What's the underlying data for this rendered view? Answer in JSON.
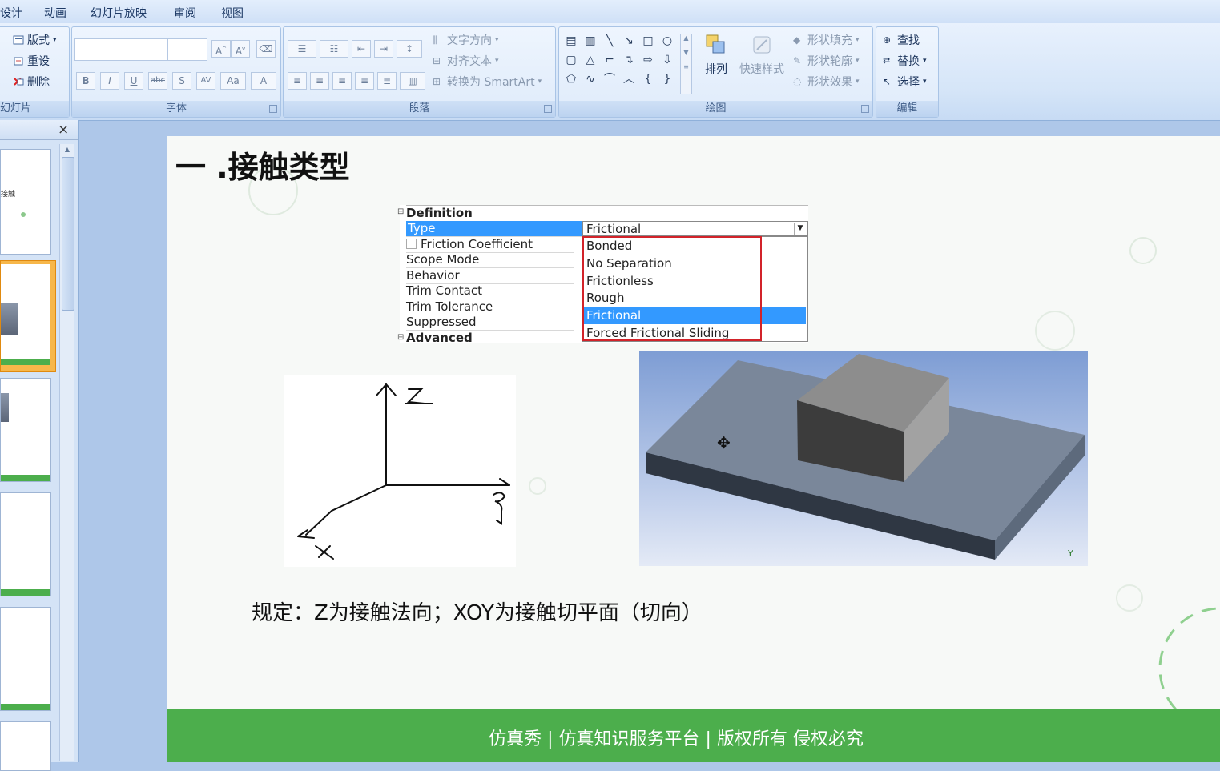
{
  "menu": [
    "设计",
    "动画",
    "幻灯片放映",
    "审阅",
    "视图"
  ],
  "ribbon": {
    "slides_group": {
      "label": "幻灯片",
      "layout": "版式",
      "reset": "重设",
      "delete": "删除"
    },
    "font_group": {
      "label": "字体",
      "buttons": [
        "B",
        "I",
        "U",
        "abc",
        "S",
        "AV",
        "Aa",
        "A"
      ]
    },
    "paragraph_group": {
      "label": "段落",
      "text_direction": "文字方向",
      "align_text": "对齐文本",
      "convert_smartart": "转换为 SmartArt"
    },
    "drawing_group": {
      "label": "绘图",
      "arrange": "排列",
      "quick_styles": "快速样式",
      "shape_fill": "形状填充",
      "shape_outline": "形状轮廓",
      "shape_effects": "形状效果"
    },
    "editing_group": {
      "label": "编辑",
      "find": "查找",
      "replace": "替换",
      "select": "选择"
    }
  },
  "thumbnail_pane": {
    "close_glyph": "×",
    "thumb1_text": "接触"
  },
  "slide": {
    "title": "一 .接触类型",
    "property_grid": {
      "section_definition": "Definition",
      "section_advanced": "Advanced",
      "rows": [
        {
          "name": "Type",
          "value": "Frictional"
        },
        {
          "name": "Friction Coefficient",
          "value": ""
        },
        {
          "name": "Scope Mode",
          "value": ""
        },
        {
          "name": "Behavior",
          "value": ""
        },
        {
          "name": "Trim Contact",
          "value": ""
        },
        {
          "name": "Trim Tolerance",
          "value": ""
        },
        {
          "name": "Suppressed",
          "value": ""
        }
      ],
      "dropdown_options": [
        "Bonded",
        "No Separation",
        "Frictionless",
        "Rough",
        "Frictional",
        "Forced Frictional Sliding"
      ],
      "selected_option": "Frictional"
    },
    "axis_sketch": {
      "z": "Z",
      "x": "X",
      "y": "y"
    },
    "model_axis_label": "Y",
    "caption": "规定：Z为接触法向；XOY为接触切平面（切向）",
    "footer": "仿真秀 | 仿真知识服务平台 | 版权所有 侵权必究"
  },
  "colors": {
    "selection_blue": "#3399ff",
    "highlight_red": "#d2232a",
    "footer_green": "#4cae4c"
  }
}
